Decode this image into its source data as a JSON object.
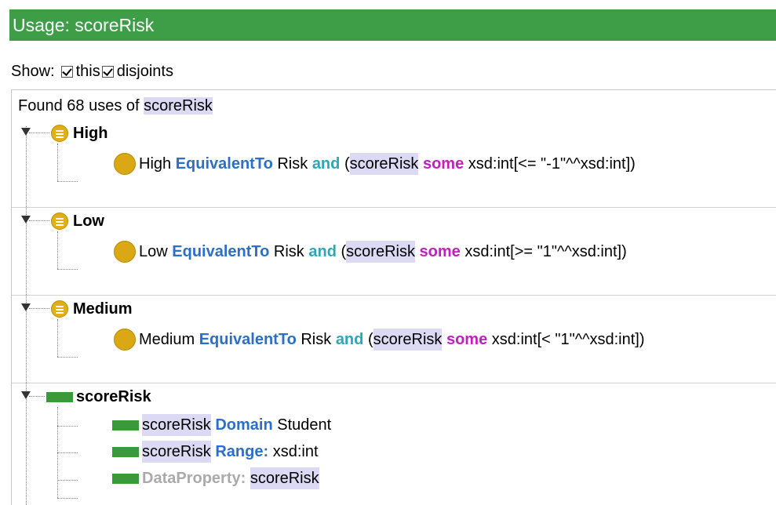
{
  "title": "Usage: scoreRisk",
  "show": {
    "label": "Show:",
    "this_label": "this",
    "this_checked": true,
    "disjoints_label": "disjoints",
    "disjoints_checked": true
  },
  "found": {
    "prefix": "Found 68 uses of",
    "entity": "scoreRisk"
  },
  "groups": [
    {
      "name": "High",
      "axiom": {
        "subject": "High",
        "equiv": "EquivalentTo",
        "cls": "Risk",
        "and": "and",
        "open": "(",
        "prop": "scoreRisk",
        "some": "some",
        "tail": "xsd:int[<= \"-1\"^^xsd:int])"
      }
    },
    {
      "name": "Low",
      "axiom": {
        "subject": "Low",
        "equiv": "EquivalentTo",
        "cls": "Risk",
        "and": "and",
        "open": "(",
        "prop": "scoreRisk",
        "some": "some",
        "tail": "xsd:int[>= \"1\"^^xsd:int])"
      }
    },
    {
      "name": "Medium",
      "axiom": {
        "subject": "Medium",
        "equiv": "EquivalentTo",
        "cls": "Risk",
        "and": "and",
        "open": "(",
        "prop": "scoreRisk",
        "some": "some",
        "tail": "xsd:int[< \"1\"^^xsd:int])"
      }
    }
  ],
  "property_group": {
    "name": "scoreRisk",
    "domain": {
      "prop": "scoreRisk",
      "kw": "Domain",
      "value": "Student"
    },
    "range": {
      "prop": "scoreRisk",
      "kw": "Range:",
      "value": "xsd:int"
    },
    "decl": {
      "kw": "DataProperty:",
      "value": "scoreRisk"
    }
  },
  "colors": {
    "title_bar": "#3e9e48",
    "keyword_blue": "#2a6fc9",
    "keyword_teal": "#2aa8b8",
    "keyword_purple": "#c020c0",
    "highlight": "#dcd9f5",
    "individual_icon": "#e3b014",
    "property_icon": "#3a9a3a"
  },
  "icons": {
    "individual": "individual-icon",
    "axiom": "axiom-icon",
    "data_property": "data-property-icon",
    "expand": "expanded-triangle-icon",
    "checkbox": "checkbox-checked-icon"
  }
}
